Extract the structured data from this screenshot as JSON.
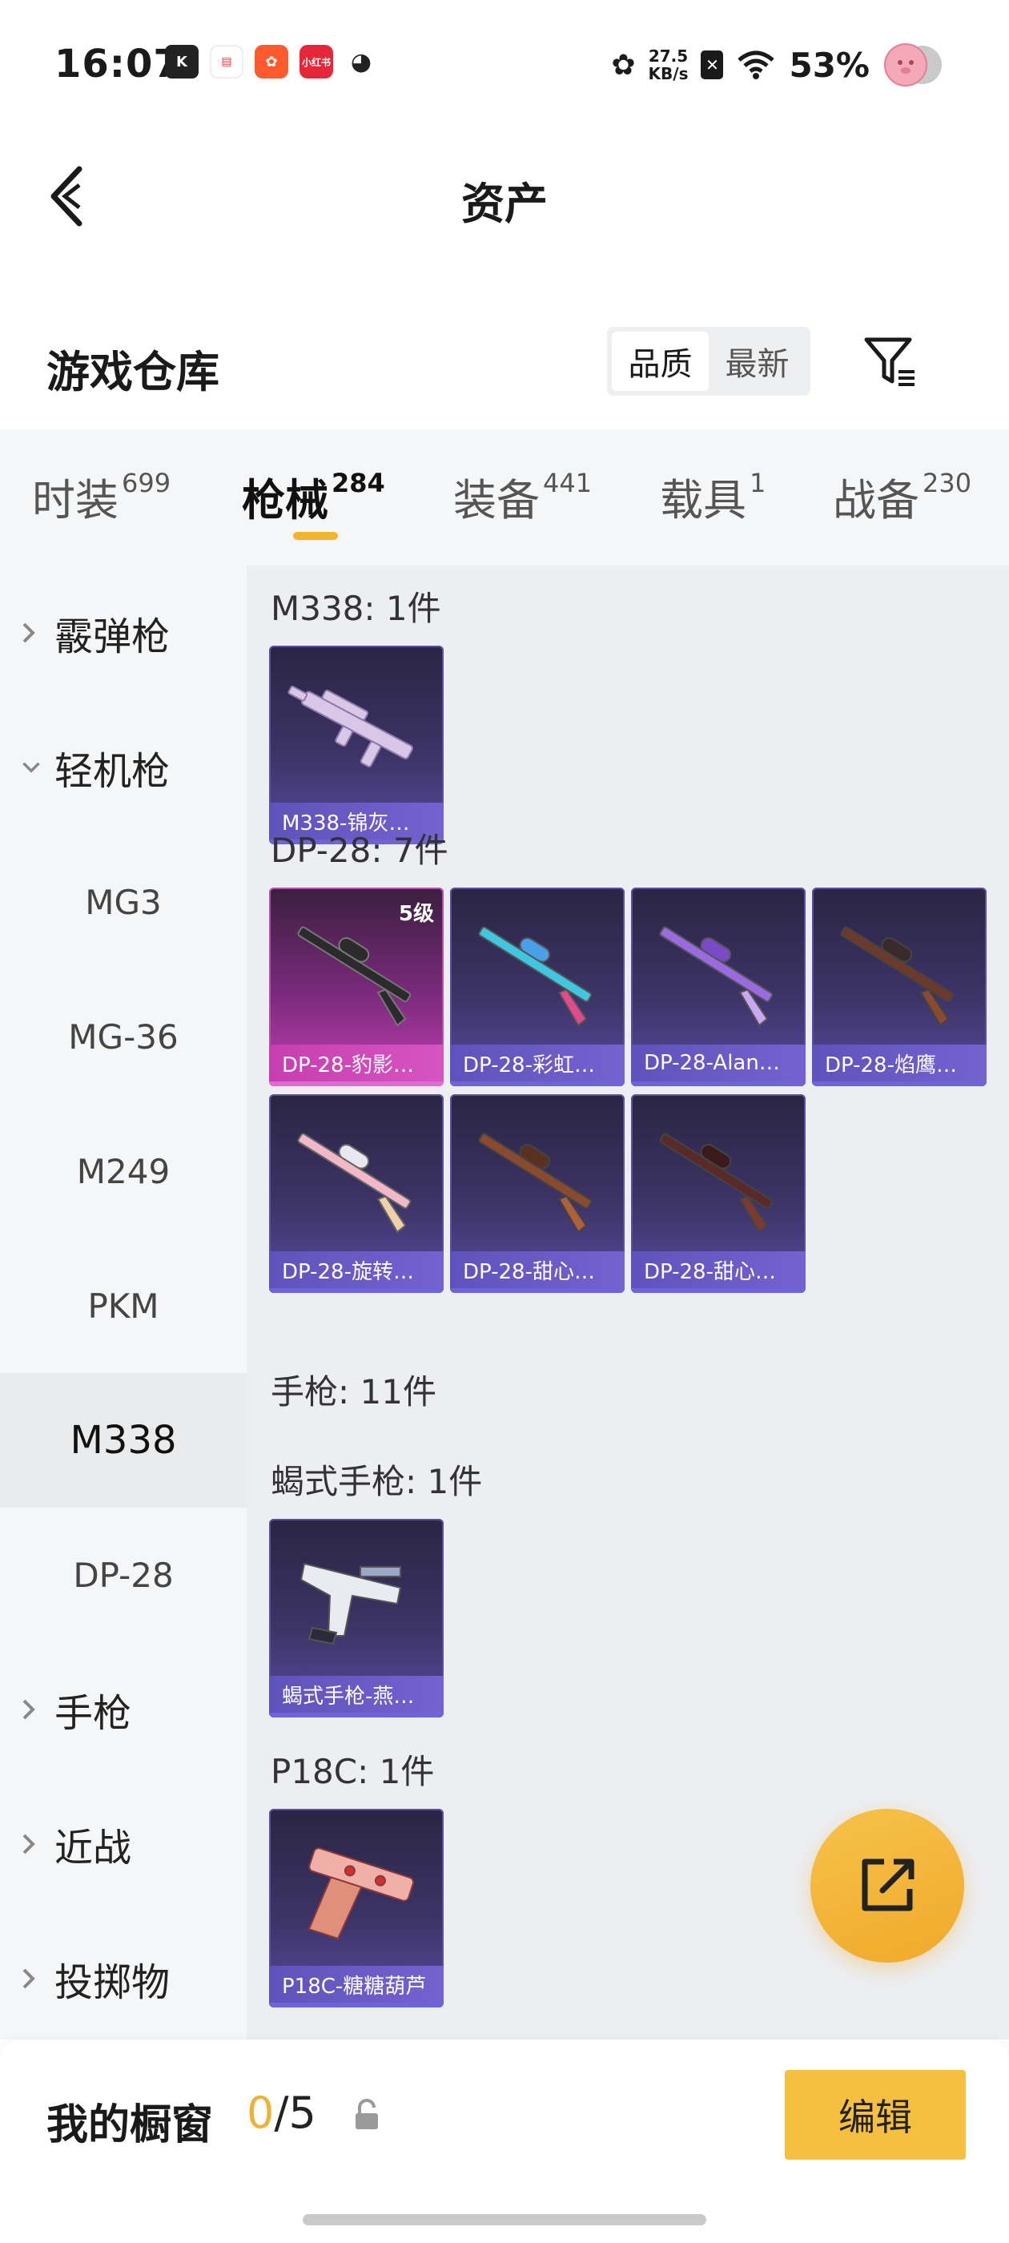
{
  "status_bar": {
    "time": "16:07",
    "net_speed_value": "27.5",
    "net_speed_unit": "KB/s",
    "battery": "53%",
    "app_icons": [
      "k-app-icon",
      "calendar-app-icon",
      "kuaishou-app-icon",
      "xiaohongshu-app-icon",
      "q-app-icon"
    ],
    "xiaohongshu_label": "小红书"
  },
  "header": {
    "title": "资产"
  },
  "warehouse": {
    "title": "游戏仓库",
    "sort_options": [
      "品质",
      "最新"
    ],
    "active_sort": "品质"
  },
  "tabs": [
    {
      "label": "时装",
      "count": "699"
    },
    {
      "label": "枪械",
      "count": "284"
    },
    {
      "label": "装备",
      "count": "441"
    },
    {
      "label": "载具",
      "count": "1"
    },
    {
      "label": "战备",
      "count": "230"
    }
  ],
  "active_tab": "枪械",
  "sidebar": {
    "items": [
      {
        "label": "霰弹枪",
        "type": "group",
        "expanded": false
      },
      {
        "label": "轻机枪",
        "type": "group",
        "expanded": true
      },
      {
        "label": "MG3",
        "type": "sub"
      },
      {
        "label": "MG-36",
        "type": "sub"
      },
      {
        "label": "M249",
        "type": "sub"
      },
      {
        "label": "PKM",
        "type": "sub"
      },
      {
        "label": "M338",
        "type": "sub",
        "selected": true
      },
      {
        "label": "DP-28",
        "type": "sub"
      },
      {
        "label": "手枪",
        "type": "group",
        "expanded": false
      },
      {
        "label": "近战",
        "type": "group",
        "expanded": false
      },
      {
        "label": "投掷物",
        "type": "group",
        "expanded": false
      }
    ]
  },
  "sections": [
    {
      "title": "M338: 1件",
      "items": [
        {
          "name": "M338-锦灰…",
          "level": ""
        }
      ]
    },
    {
      "title": "DP-28: 7件",
      "items": [
        {
          "name": "DP-28-豹影…",
          "level": "5级",
          "rarity": "pink"
        },
        {
          "name": "DP-28-彩虹…",
          "level": ""
        },
        {
          "name": "DP-28-Alan…",
          "level": ""
        },
        {
          "name": "DP-28-焰鹰…",
          "level": ""
        },
        {
          "name": "DP-28-旋转…",
          "level": ""
        },
        {
          "name": "DP-28-甜心…",
          "level": ""
        },
        {
          "name": "DP-28-甜心…",
          "level": ""
        }
      ]
    },
    {
      "title": "手枪: 11件",
      "items": []
    },
    {
      "title": "蝎式手枪: 1件",
      "items": [
        {
          "name": "蝎式手枪-燕…",
          "level": ""
        }
      ]
    },
    {
      "title": "P18C: 1件",
      "items": [
        {
          "name": "P18C-糖糖葫芦",
          "level": ""
        }
      ]
    }
  ],
  "fab": {
    "icon": "share-icon"
  },
  "bottom_bar": {
    "title": "我的橱窗",
    "count_used": "0",
    "count_total": "/5",
    "edit_label": "编辑"
  },
  "colors": {
    "accent": "#f5bf3f",
    "card_purple": "#5a4aa0",
    "card_pink": "#c23fb2"
  }
}
